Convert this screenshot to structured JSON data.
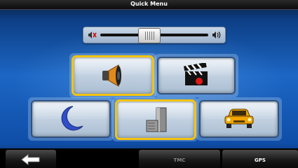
{
  "window": {
    "title": "Quick Menu"
  },
  "volume": {
    "level_fraction": 0.45,
    "muted_icon": "speaker-muted-icon",
    "loud_icon": "speaker-loud-icon"
  },
  "tiles": [
    {
      "icon": "speaker-icon",
      "selected": true
    },
    {
      "icon": "clapperboard-icon",
      "selected": false
    },
    {
      "icon": "moon-icon",
      "selected": false
    },
    {
      "icon": "building-icon",
      "selected": true
    },
    {
      "icon": "car-icon",
      "selected": false
    }
  ],
  "bottom_bar": {
    "back_icon": "back-arrow-icon",
    "tmc_label": "TMC",
    "gps_label": "GPS"
  },
  "colors": {
    "selected": "#f2c40f",
    "background": "#1c66c4",
    "tmc_text": "#888888",
    "gps_text": "#ffffff"
  }
}
